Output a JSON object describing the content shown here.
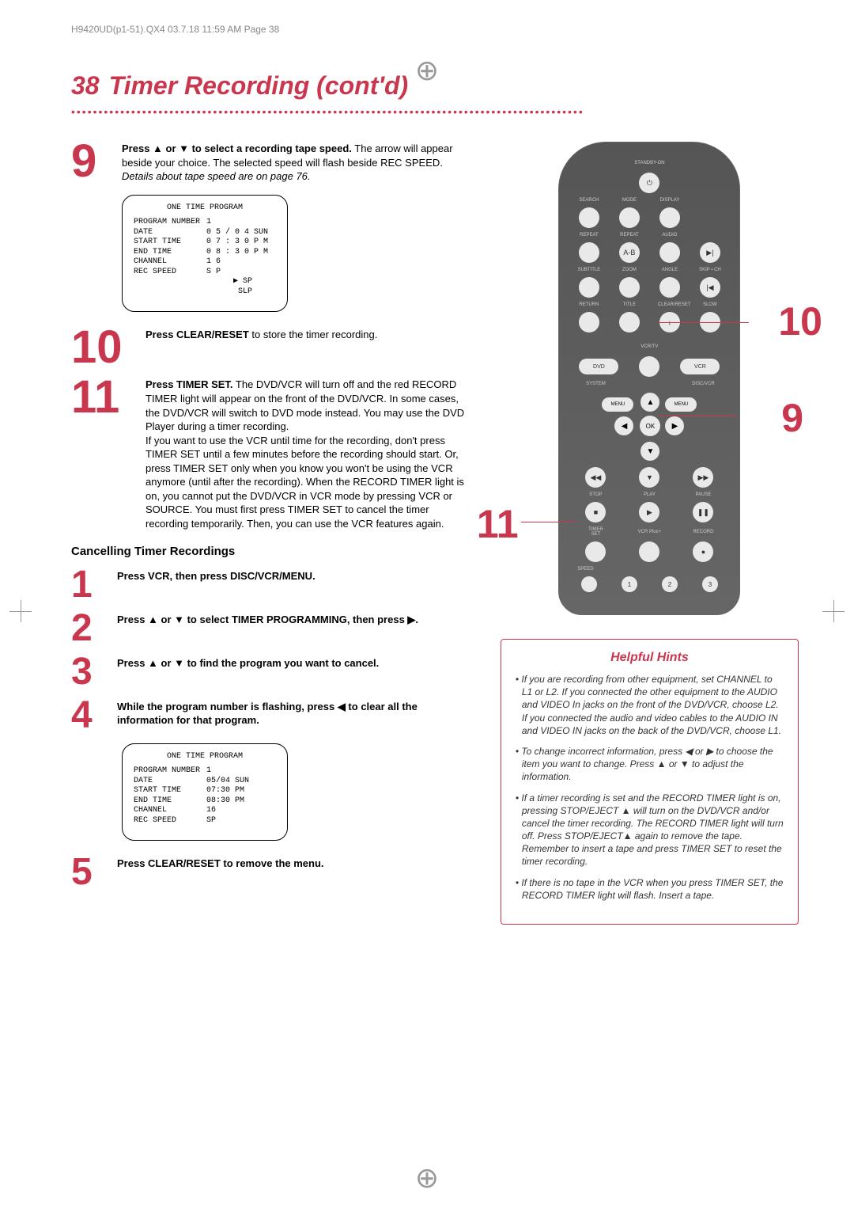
{
  "print_header": "H9420UD(p1-51).QX4  03.7.18  11:59 AM  Page 38",
  "page_number": "38",
  "page_title": "Timer Recording (cont'd)",
  "steps_main": [
    {
      "num": "9",
      "body_html": "<b>Press ▲ or ▼ to select a recording tape speed.</b> The arrow will appear beside your choice. The selected speed will flash beside REC SPEED. <i>Details about tape speed are on page 76.</i>"
    },
    {
      "num": "10",
      "body_html": "<b>Press CLEAR/RESET</b> to store the timer recording."
    },
    {
      "num": "11",
      "body_html": "<b>Press TIMER SET.</b> The DVD/VCR will turn off and the red RECORD TIMER light will appear on the front of the DVD/VCR. In some cases, the DVD/VCR will switch to DVD mode instead. You may use the DVD Player during a timer recording.<br>If you want to use the VCR until time for the recording, don't press TIMER SET until a few minutes before the recording should start. Or, press TIMER SET only when you know you won't be using the VCR anymore (until after the recording). When the RECORD TIMER light is on, you cannot put the DVD/VCR in VCR mode by pressing VCR or SOURCE. You must first press TIMER SET to cancel the timer recording temporarily. Then, you can use the VCR features again."
    }
  ],
  "lcd1": {
    "title": "ONE TIME PROGRAM",
    "rows": [
      {
        "k": "PROGRAM NUMBER",
        "v": "1"
      },
      {
        "k": "DATE",
        "v": "0 5 / 0 4  SUN"
      },
      {
        "k": "START TIME",
        "v": "0 7 : 3 0  P M"
      },
      {
        "k": "END   TIME",
        "v": "0 8 : 3 0  P M"
      },
      {
        "k": "CHANNEL",
        "v": "1 6"
      },
      {
        "k": "REC SPEED",
        "v": "S P"
      }
    ],
    "extra": [
      "▶ SP",
      "SLP"
    ]
  },
  "cancel_heading": "Cancelling Timer Recordings",
  "steps_cancel": [
    {
      "num": "1",
      "body_html": "<b>Press VCR, then press DISC/VCR/MENU.</b>"
    },
    {
      "num": "2",
      "body_html": "<b>Press ▲ or ▼ to select TIMER PROGRAMMING, then press ▶.</b>"
    },
    {
      "num": "3",
      "body_html": "<b>Press ▲ or ▼ to find the program you want to cancel.</b>"
    },
    {
      "num": "4",
      "body_html": "<b>While the program number is flashing, press ◀ to clear all the information for that program.</b>"
    },
    {
      "num": "5",
      "body_html": "<b>Press CLEAR/RESET to remove the menu.</b>"
    }
  ],
  "lcd2": {
    "title": "ONE TIME PROGRAM",
    "rows": [
      {
        "k": "PROGRAM NUMBER",
        "v": "1"
      },
      {
        "k": "DATE",
        "v": "05/04   SUN"
      },
      {
        "k": "START  TIME",
        "v": "07:30    PM"
      },
      {
        "k": "END    TIME",
        "v": "08:30    PM"
      },
      {
        "k": "CHANNEL",
        "v": "16"
      },
      {
        "k": "REC SPEED",
        "v": "SP"
      }
    ]
  },
  "remote": {
    "top_label": "STANDBY-ON",
    "row1": [
      "SEARCH",
      "MODE",
      "DISPLAY"
    ],
    "row2": [
      "REPEAT",
      "REPEAT",
      "AUDIO"
    ],
    "row2_btn": [
      "",
      "A-B",
      "",
      "▶|"
    ],
    "row3": [
      "SUBTITLE",
      "ZOOM",
      "ANGLE",
      "SKIP ▪ CH"
    ],
    "row3_btn": [
      "",
      "",
      "",
      "|◀"
    ],
    "row4": [
      "RETURN",
      "TITLE",
      "CLEAR/RESET",
      "SLOW"
    ],
    "row5_label": "VCR/TV",
    "row5_btn_left": "DVD",
    "row5_btn_right": "VCR",
    "row6_left": "SYSTEM",
    "row6_right": "DISC/VCR",
    "menu_left": "MENU",
    "menu_right": "MENU",
    "ok": "OK",
    "transport_row_top": [
      "◀◀",
      "▼",
      "▶▶"
    ],
    "transport_labels": [
      "STOP",
      "PLAY",
      "PAUSE"
    ],
    "transport_btns": [
      "■",
      "▶",
      "❚❚"
    ],
    "bottom_labels": [
      "TIMER SET",
      "VCR Plus+",
      "RECORD"
    ],
    "bottom_btns": [
      "",
      "",
      "●"
    ],
    "speed_label": "SPEED",
    "num_btns": [
      "1",
      "2",
      "3"
    ]
  },
  "callouts": {
    "c9": "9",
    "c10": "10",
    "c11": "11"
  },
  "hints": {
    "title": "Helpful Hints",
    "items": [
      "If you are recording from other equipment, set CHANNEL to L1 or L2. If you connected the other equipment to the AUDIO and VIDEO In jacks on the front of the DVD/VCR, choose L2. If you connected the audio and video cables to the AUDIO IN and VIDEO IN jacks on the back of the DVD/VCR, choose L1.",
      "To change incorrect information, press ◀ or ▶ to choose the item you want to change. Press ▲ or ▼ to adjust the information.",
      "If a timer recording is set and the RECORD TIMER light is on, pressing STOP/EJECT ▲ will turn on the DVD/VCR and/or cancel the timer recording. The RECORD TIMER light will turn off. Press STOP/EJECT▲ again to remove the tape. Remember to insert a tape and press TIMER SET to reset the timer recording.",
      "If there is no tape in the VCR when you press TIMER SET, the RECORD TIMER light will flash. Insert a tape."
    ]
  }
}
